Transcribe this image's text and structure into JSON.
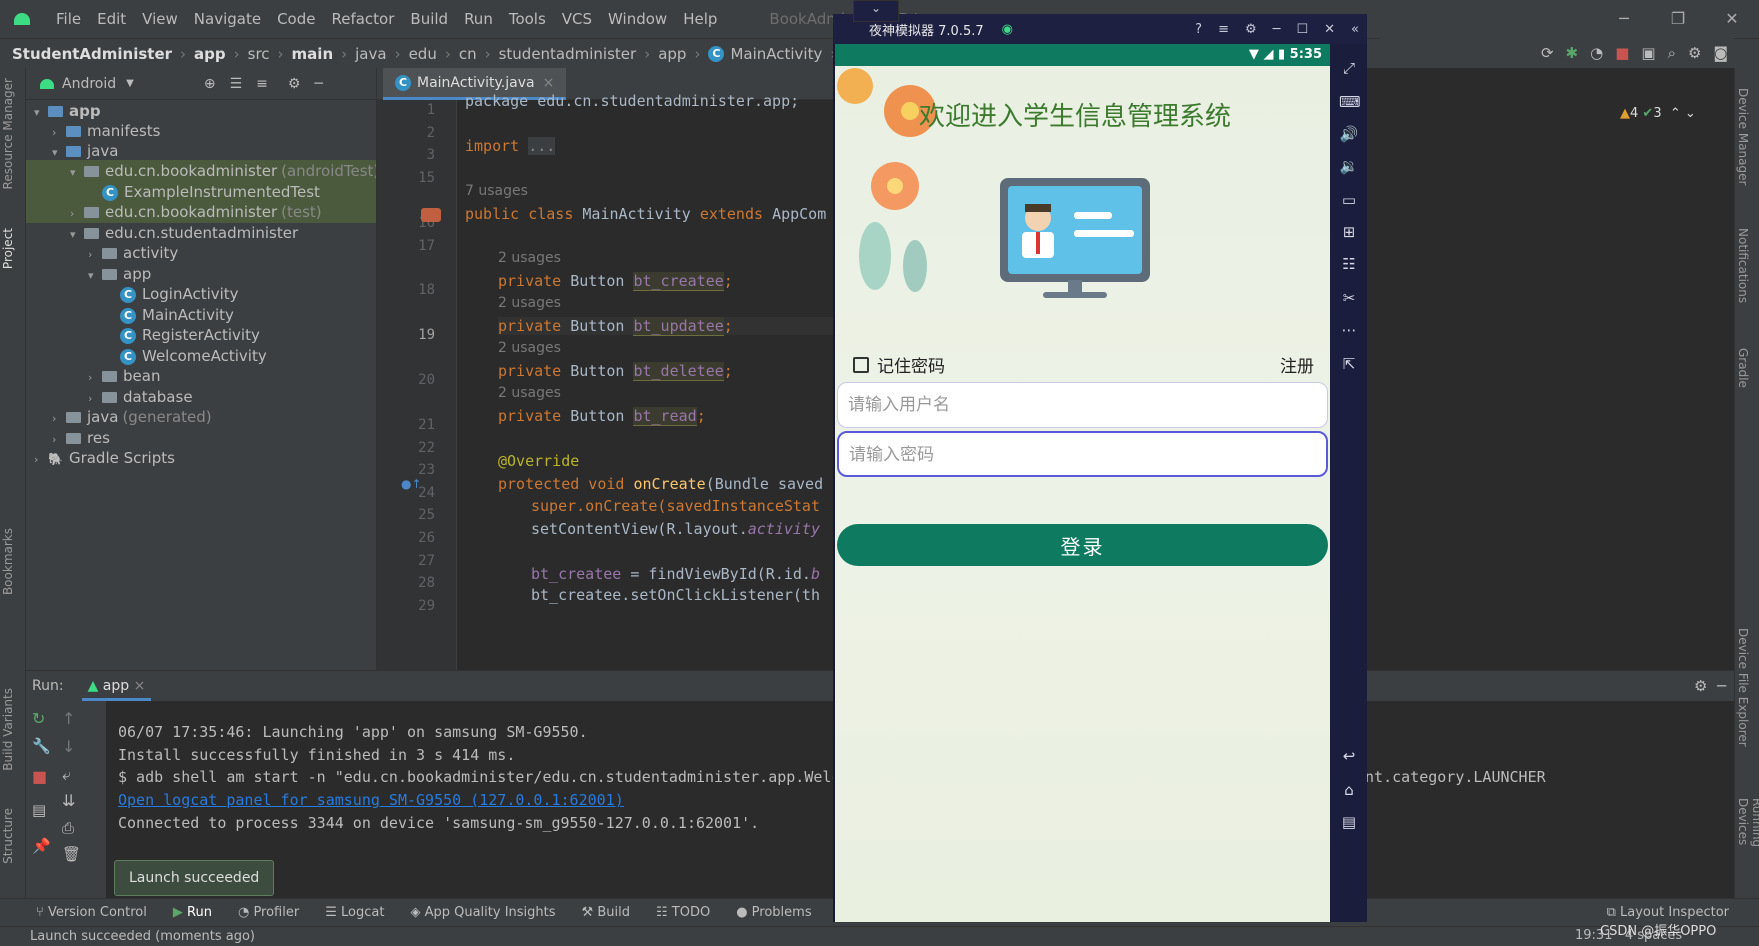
{
  "menu": {
    "items": [
      "File",
      "Edit",
      "View",
      "Navigate",
      "Code",
      "Refactor",
      "Build",
      "Run",
      "Tools",
      "VCS",
      "Window",
      "Help"
    ],
    "project_title": "BookAdminister [D:\\a"
  },
  "breadcrumb": {
    "items": [
      "StudentAdminister",
      "app",
      "src",
      "main",
      "java",
      "edu",
      "cn",
      "studentadminister",
      "app",
      "MainActivity",
      "bt_updatee"
    ]
  },
  "project_panel": {
    "view": "Android",
    "tree": [
      {
        "label": "app",
        "indent": 0,
        "arrow": "v",
        "icon": "module",
        "suffix": ""
      },
      {
        "label": "manifests",
        "indent": 1,
        "arrow": ">",
        "icon": "folder-blue",
        "suffix": ""
      },
      {
        "label": "java",
        "indent": 1,
        "arrow": "v",
        "icon": "folder-blue",
        "suffix": ""
      },
      {
        "label": "edu.cn.bookadminister",
        "indent": 2,
        "arrow": "v",
        "icon": "folder",
        "suffix": "(androidTest)"
      },
      {
        "label": "ExampleInstrumentedTest",
        "indent": 3,
        "arrow": "",
        "icon": "class",
        "suffix": ""
      },
      {
        "label": "edu.cn.bookadminister",
        "indent": 2,
        "arrow": ">",
        "icon": "folder",
        "suffix": "(test)"
      },
      {
        "label": "edu.cn.studentadminister",
        "indent": 2,
        "arrow": "v",
        "icon": "folder",
        "suffix": ""
      },
      {
        "label": "activity",
        "indent": 3,
        "arrow": ">",
        "icon": "folder",
        "suffix": ""
      },
      {
        "label": "app",
        "indent": 3,
        "arrow": "v",
        "icon": "folder",
        "suffix": ""
      },
      {
        "label": "LoginActivity",
        "indent": 4,
        "arrow": "",
        "icon": "class",
        "suffix": ""
      },
      {
        "label": "MainActivity",
        "indent": 4,
        "arrow": "",
        "icon": "class",
        "suffix": ""
      },
      {
        "label": "RegisterActivity",
        "indent": 4,
        "arrow": "",
        "icon": "class",
        "suffix": ""
      },
      {
        "label": "WelcomeActivity",
        "indent": 4,
        "arrow": "",
        "icon": "class",
        "suffix": ""
      },
      {
        "label": "bean",
        "indent": 3,
        "arrow": ">",
        "icon": "folder",
        "suffix": ""
      },
      {
        "label": "database",
        "indent": 3,
        "arrow": ">",
        "icon": "folder",
        "suffix": ""
      },
      {
        "label": "java",
        "indent": 1,
        "arrow": ">",
        "icon": "folder-gen",
        "suffix": "(generated)"
      },
      {
        "label": "res",
        "indent": 1,
        "arrow": ">",
        "icon": "folder-res",
        "suffix": ""
      },
      {
        "label": "Gradle Scripts",
        "indent": 0,
        "arrow": ">",
        "icon": "gradle",
        "suffix": ""
      }
    ]
  },
  "editor": {
    "tab": "MainActivity.java",
    "line_numbers": [
      "1",
      "2",
      "3",
      "15",
      "16",
      "17",
      "18",
      "19",
      "20",
      "21",
      "22",
      "23",
      "24",
      "25",
      "26",
      "27",
      "28",
      "29"
    ],
    "usages_7": "7 usages",
    "usages_2": "2 usages",
    "code": {
      "l1": "package edu.cn.studentadminister.app;",
      "l3_kw": "import",
      "l3_rest": "...",
      "l16_kw": "public class",
      "l16_name": "MainActivity",
      "l16_ext": "extends",
      "l16_base": "AppCom",
      "priv": "private",
      "btn": "Button",
      "f1": "bt_createe",
      "f2": "bt_updatee",
      "f3": "bt_deletee",
      "f4": "bt_read",
      "override": "@Override",
      "l24_kw": "protected void",
      "l24_fn": "onCreate",
      "l24_rest": "(Bundle saved",
      "l25": "super.onCreate(savedInstanceStat",
      "l26a": "setContentView(R.layout.",
      "l26b": "activity",
      "l28a": "bt_createe",
      "l28b": " = findViewById(R.id.",
      "l28c": "b",
      "l29": "bt_createe.setOnClickListener(th"
    }
  },
  "run": {
    "label": "Run:",
    "config": "app",
    "lines": [
      "06/07 17:35:46: Launching 'app' on samsung SM-G9550.",
      "Install successfully finished in 3 s 414 ms.",
      "$ adb shell am start -n \"edu.cn.bookadminister/edu.cn.studentadminister.app.Welc"
    ],
    "line3_tail": "ent.category.LAUNCHER",
    "link": "Open logcat panel for samsung SM-G9550 (127.0.0.1:62001)",
    "line5": "Connected to process 3344 on device 'samsung-sm_g9550-127.0.0.1:62001'.",
    "toast": "Launch succeeded"
  },
  "bottom_tabs": [
    "Version Control",
    "Run",
    "Profiler",
    "Logcat",
    "App Quality Insights",
    "Build",
    "TODO",
    "Problems",
    "Te"
  ],
  "layout_inspector": "Layout Inspector",
  "status": {
    "message": "Launch succeeded (moments ago)",
    "position": "19:31",
    "indent": "4 spaces"
  },
  "inspections": {
    "warnings": "4",
    "weak": "3"
  },
  "emulator": {
    "title": "夜神模拟器 7.0.5.7",
    "phone_time": "5:35",
    "app_title": "欢迎进入学生信息管理系统",
    "remember_label": "记住密码",
    "register_label": "注册",
    "username_placeholder": "请输入用户名",
    "password_placeholder": "请输入密码",
    "login_label": "登录",
    "accent_color": "#0e7a60"
  },
  "side_tabs_left": [
    "Resource Manager",
    "Project",
    "Bookmarks",
    "Build Variants",
    "Structure"
  ],
  "side_tabs_right": [
    "Device Manager",
    "Notifications",
    "Gradle",
    "Device File Explorer",
    "Running Devices"
  ],
  "watermark": "CSDN @振华OPPO"
}
